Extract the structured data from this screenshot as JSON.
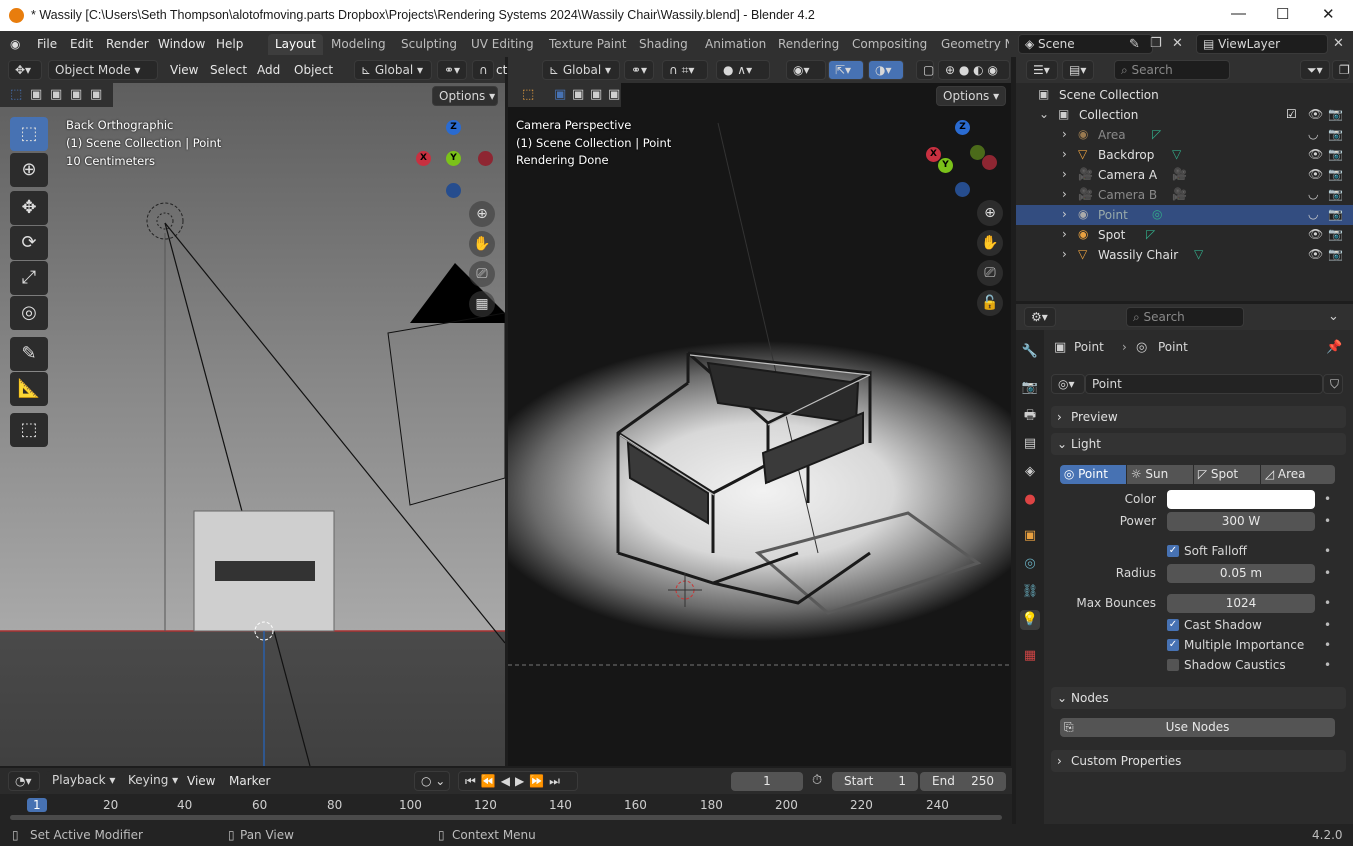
{
  "window": {
    "title": "* Wassily [C:\\Users\\Seth Thompson\\alotofmoving.parts Dropbox\\Projects\\Rendering Systems 2024\\Wassily Chair\\Wassily.blend] - Blender 4.2"
  },
  "menu": [
    "File",
    "Edit",
    "Render",
    "Window",
    "Help"
  ],
  "workspaces": [
    "Layout",
    "Modeling",
    "Sculpting",
    "UV Editing",
    "Texture Paint",
    "Shading",
    "Animation",
    "Rendering",
    "Compositing",
    "Geometry Nc"
  ],
  "scene": {
    "label": "Scene",
    "view_layer": "ViewLayer"
  },
  "left_header": {
    "mode": "Object Mode",
    "view": "View",
    "select": "Select",
    "add": "Add",
    "object": "Object",
    "orientation": "Global",
    "cut": "ct",
    "options": "Options"
  },
  "left_viewport": {
    "line1": "Back Orthographic",
    "line2": "(1) Scene Collection | Point",
    "line3": "10 Centimeters"
  },
  "right_header": {
    "orientation": "Global",
    "options": "Options"
  },
  "right_viewport": {
    "line1": "Camera Perspective",
    "line2": "(1) Scene Collection | Point",
    "line3": "Rendering Done"
  },
  "gizmo": {
    "z": "Z",
    "y": "Y",
    "x": "X"
  },
  "outliner": {
    "search_placeholder": "Search",
    "root": "Scene Collection",
    "collection": "Collection",
    "items": [
      {
        "name": "Area",
        "visible": false
      },
      {
        "name": "Backdrop",
        "visible": true
      },
      {
        "name": "Camera A",
        "visible": true
      },
      {
        "name": "Camera B",
        "visible": false
      },
      {
        "name": "Point",
        "visible": false
      },
      {
        "name": "Spot",
        "visible": true
      },
      {
        "name": "Wassily Chair",
        "visible": true
      }
    ]
  },
  "properties": {
    "search_placeholder": "Search",
    "breadcrumb_obj": "Point",
    "breadcrumb_data": "Point",
    "datablock": "Point",
    "panel_preview": "Preview",
    "panel_light": "Light",
    "light_types": [
      "Point",
      "Sun",
      "Spot",
      "Area"
    ],
    "color_label": "Color",
    "power_label": "Power",
    "power": "300 W",
    "soft_falloff": "Soft Falloff",
    "radius_label": "Radius",
    "radius": "0.05 m",
    "max_bounces_label": "Max Bounces",
    "max_bounces": "1024",
    "cast_shadow": "Cast Shadow",
    "multiple_importance": "Multiple Importance",
    "shadow_caustics": "Shadow Caustics",
    "panel_nodes": "Nodes",
    "use_nodes": "Use Nodes",
    "panel_custom": "Custom Properties",
    "light_color": "#ffffff"
  },
  "timeline": {
    "playback": "Playback",
    "keying": "Keying",
    "view": "View",
    "marker": "Marker",
    "current_frame": "1",
    "start_label": "Start",
    "start": "1",
    "end_label": "End",
    "end": "250",
    "ticks": [
      "1",
      "20",
      "40",
      "60",
      "80",
      "100",
      "120",
      "140",
      "160",
      "180",
      "200",
      "220",
      "240"
    ]
  },
  "status": {
    "left": "Set Active Modifier",
    "middle": "Pan View",
    "right": "Context Menu",
    "version": "4.2.0"
  }
}
